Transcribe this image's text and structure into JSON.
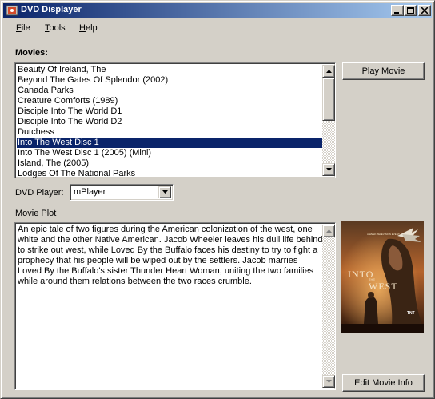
{
  "window": {
    "title": "DVD Displayer"
  },
  "menu": {
    "file": {
      "mnemonic": "F",
      "rest": "ile"
    },
    "tools": {
      "mnemonic": "T",
      "rest": "ools"
    },
    "help": {
      "mnemonic": "H",
      "rest": "elp"
    }
  },
  "movies": {
    "label": "Movies:",
    "items": [
      "Beauty Of Ireland, The",
      "Beyond The Gates Of Splendor (2002)",
      "Canada Parks",
      "Creature Comforts (1989)",
      "Disciple Into The World D1",
      "Disciple Into The World D2",
      "Dutchess",
      "Into The West Disc 1",
      "Into The West Disc 1 (2005) (Mini)",
      "Island, The (2005)",
      "Lodges Of The National Parks"
    ],
    "selected_index": 7
  },
  "buttons": {
    "play": "Play Movie",
    "edit": "Edit Movie Info"
  },
  "player": {
    "label": "DVD Player:",
    "selected": "mPlayer"
  },
  "plot": {
    "label": "Movie Plot",
    "text": "An epic tale of two figures during the American colonization of the west, one white and the other Native American. Jacob Wheeler leaves his dull life behind to strike out west, while Loved By the Buffalo faces his destiny to try to fight a prophecy that his people will be wiped out by the settlers. Jacob marries Loved By the Buffalo's sister Thunder Heart Woman, uniting the two families while around them relations between the two races crumble."
  },
  "poster": {
    "top_text": "A WEEK TELEVISION EVENT",
    "title_line1": "INTO",
    "title_line2": "WEST",
    "title_small": "THE",
    "network": "TNT"
  },
  "colors": {
    "window_bg": "#d4d0c8",
    "titlebar_start": "#0a246a",
    "titlebar_end": "#a6caf0",
    "selection": "#0a246a"
  }
}
